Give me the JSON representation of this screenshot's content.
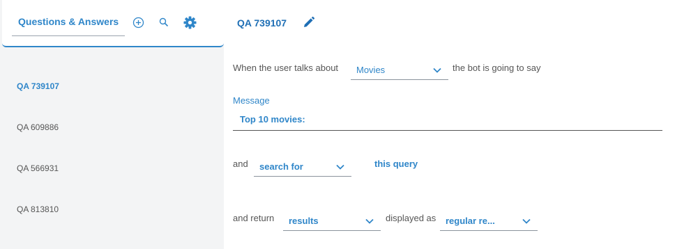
{
  "sidebar": {
    "title": "Questions & Answers",
    "items": [
      {
        "label": "QA 739107",
        "active": true
      },
      {
        "label": "QA 609886",
        "active": false
      },
      {
        "label": "QA 566931",
        "active": false
      },
      {
        "label": "QA 813810",
        "active": false
      }
    ],
    "icons": [
      "add-circle-icon",
      "search-icon",
      "gear-icon"
    ]
  },
  "main": {
    "title": "QA 739107",
    "row1": {
      "prefix": "When the user talks about",
      "topic": "Movies",
      "suffix": "the bot is going to say"
    },
    "message": {
      "label": "Message",
      "value": "Top 10 movies:"
    },
    "row2": {
      "prefix": "and",
      "action": "search for",
      "link": "this query"
    },
    "row3": {
      "prefix": "and return",
      "return_value": "results",
      "middle": "displayed as",
      "display_value": "regular re..."
    }
  },
  "colors": {
    "accent": "#2f86c9",
    "title_blue": "#1f6fb5",
    "sidebar_bg": "#f3f4f5"
  }
}
